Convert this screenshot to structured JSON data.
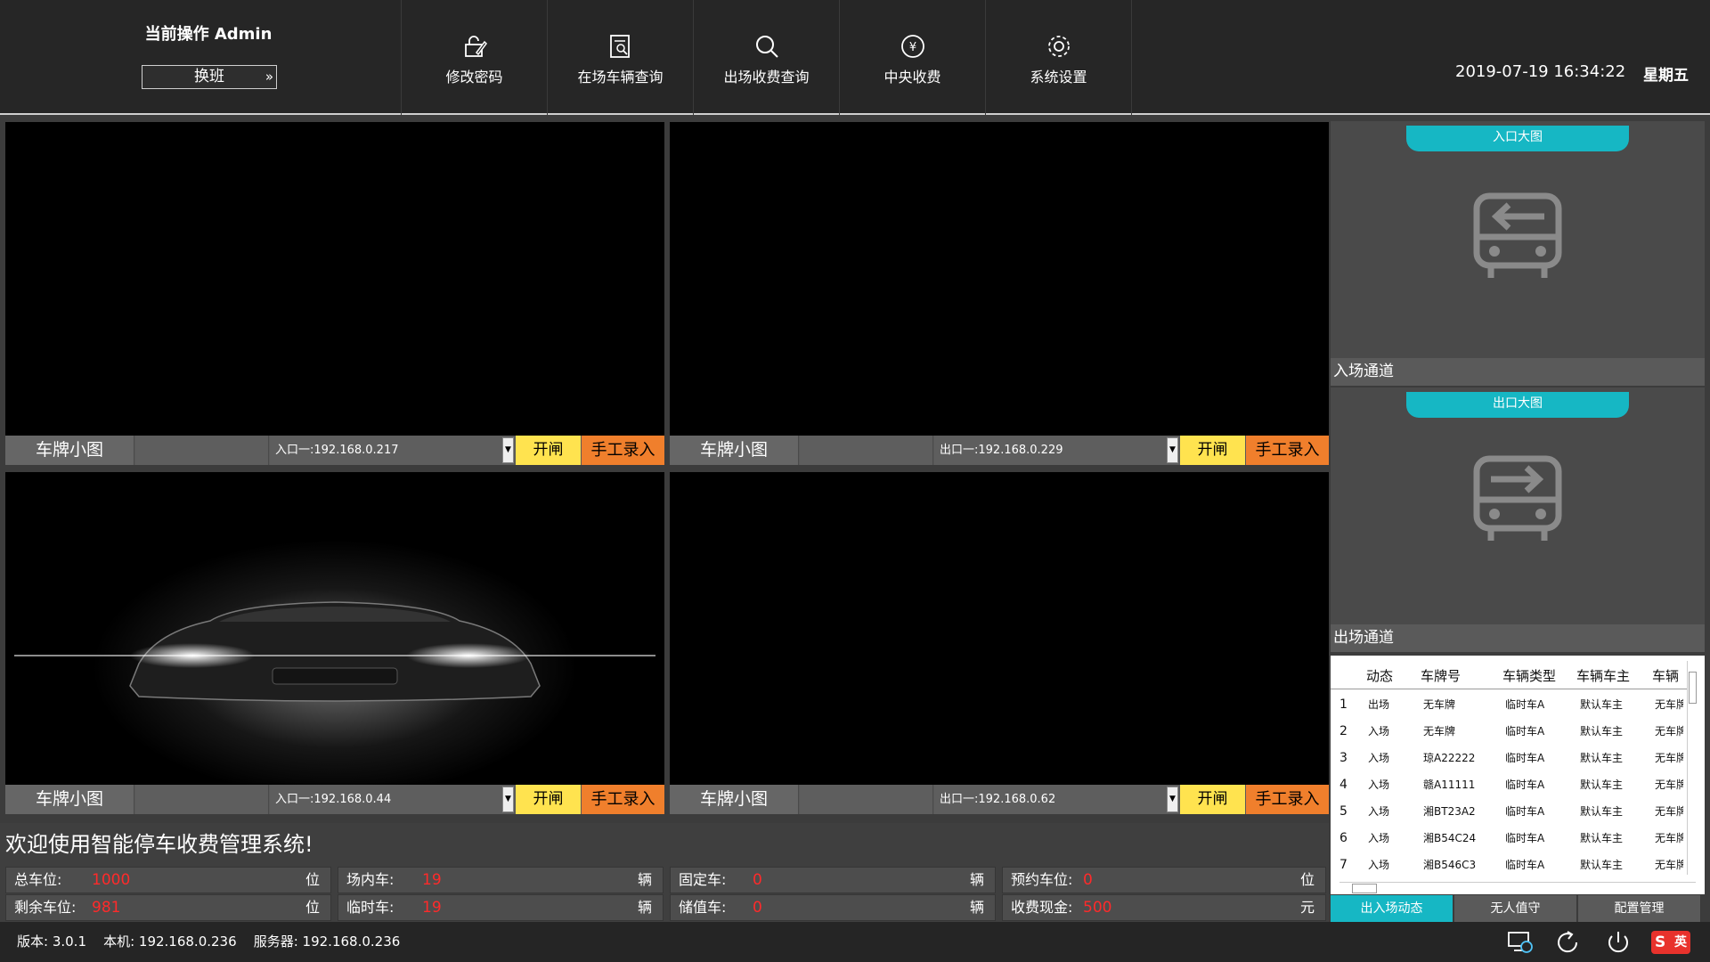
{
  "header": {
    "operator_label": "当前操作 Admin",
    "shift_button": "换班",
    "nav": [
      {
        "label": "修改密码",
        "icon": "lock-edit-icon"
      },
      {
        "label": "在场车辆查询",
        "icon": "doc-search-icon"
      },
      {
        "label": "出场收费查询",
        "icon": "search-icon"
      },
      {
        "label": "中央收费",
        "icon": "yen-icon"
      },
      {
        "label": "系统设置",
        "icon": "gear-icon"
      }
    ],
    "datetime": "2019-07-19 16:34:22",
    "weekday": "星期五"
  },
  "panels": [
    {
      "plate_label": "车牌小图",
      "camera": "入口一:192.168.0.217",
      "open": "开闸",
      "manual": "手工录入"
    },
    {
      "plate_label": "车牌小图",
      "camera": "出口一:192.168.0.229",
      "open": "开闸",
      "manual": "手工录入"
    },
    {
      "plate_label": "车牌小图",
      "camera": "入口一:192.168.0.44",
      "open": "开闸",
      "manual": "手工录入"
    },
    {
      "plate_label": "车牌小图",
      "camera": "出口一:192.168.0.62",
      "open": "开闸",
      "manual": "手工录入"
    }
  ],
  "welcome": "欢迎使用智能停车收费管理系统!",
  "stats": [
    {
      "key": "总车位:",
      "value": "1000",
      "unit": "位"
    },
    {
      "key": "场内车:",
      "value": "19",
      "unit": "辆"
    },
    {
      "key": "固定车:",
      "value": "0",
      "unit": "辆"
    },
    {
      "key": "预约车位:",
      "value": "0",
      "unit": "位"
    },
    {
      "key": "剩余车位:",
      "value": "981",
      "unit": "位"
    },
    {
      "key": "临时车:",
      "value": "19",
      "unit": "辆"
    },
    {
      "key": "储值车:",
      "value": "0",
      "unit": "辆"
    },
    {
      "key": "收费现金:",
      "value": "500",
      "unit": "元"
    }
  ],
  "right": {
    "entrance_pill": "入口大图",
    "entrance_channel": "入场通道",
    "exit_pill": "出口大图",
    "exit_channel": "出场通道",
    "table": {
      "headers": [
        "动态",
        "车牌号",
        "车辆类型",
        "车辆车主",
        "车辆"
      ],
      "rows": [
        [
          "1",
          "出场",
          "无车牌",
          "临时车A",
          "默认车主",
          "无车牌"
        ],
        [
          "2",
          "入场",
          "无车牌",
          "临时车A",
          "默认车主",
          "无车牌"
        ],
        [
          "3",
          "入场",
          "琼A22222",
          "临时车A",
          "默认车主",
          "无车牌"
        ],
        [
          "4",
          "入场",
          "赣A11111",
          "临时车A",
          "默认车主",
          "无车牌"
        ],
        [
          "5",
          "入场",
          "湘BT23A2",
          "临时车A",
          "默认车主",
          "无车牌"
        ],
        [
          "6",
          "入场",
          "湘B54C24",
          "临时车A",
          "默认车主",
          "无车牌"
        ],
        [
          "7",
          "入场",
          "湘B546C3",
          "临时车A",
          "默认车主",
          "无车牌"
        ]
      ]
    },
    "tabs": [
      "出入场动态",
      "无人值守",
      "配置管理"
    ]
  },
  "footer": {
    "version": "版本: 3.0.1",
    "local": "本机: 192.168.0.236",
    "server": "服务器: 192.168.0.236",
    "ime": "英"
  },
  "colors": {
    "accent": "#16b7c4",
    "open": "#ffe34f",
    "manual": "#f07f2c",
    "value": "#ff2a2a"
  }
}
